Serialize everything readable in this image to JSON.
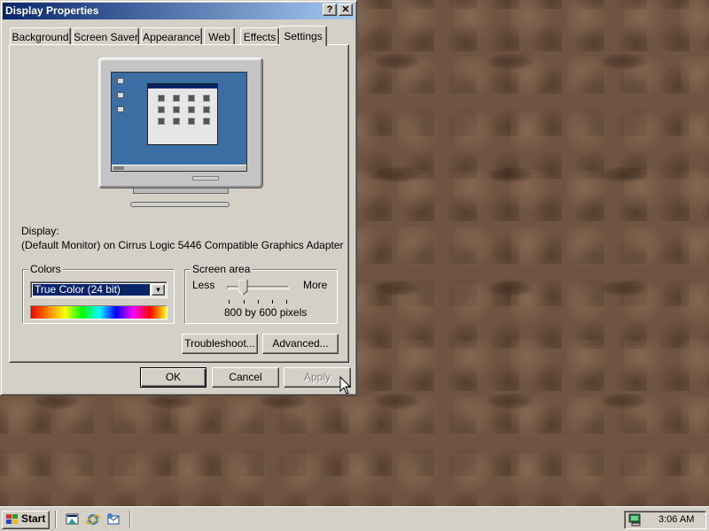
{
  "window": {
    "title": "Display Properties",
    "help_glyph": "?",
    "close_glyph": "✕"
  },
  "tabs": [
    {
      "label": "Background",
      "active": false
    },
    {
      "label": "Screen Saver",
      "active": false
    },
    {
      "label": "Appearance",
      "active": false
    },
    {
      "label": "Web",
      "active": false
    },
    {
      "label": "Effects",
      "active": false
    },
    {
      "label": "Settings",
      "active": true
    }
  ],
  "settings": {
    "display_label": "Display:",
    "display_value": "(Default Monitor) on Cirrus Logic 5446 Compatible Graphics Adapter",
    "colors": {
      "legend": "Colors",
      "selected": "True Color (24 bit)",
      "arrow_glyph": "▼"
    },
    "screen_area": {
      "legend": "Screen area",
      "less_label": "Less",
      "more_label": "More",
      "resolution": "800 by 600 pixels",
      "slider_step": 1,
      "slider_steps_total": 5
    },
    "troubleshoot_label": "Troubleshoot...",
    "advanced_label": "Advanced..."
  },
  "dialog_buttons": {
    "ok_label": "OK",
    "cancel_label": "Cancel",
    "apply_label": "Apply",
    "apply_disabled": true
  },
  "taskbar": {
    "start_label": "Start",
    "quick_launch": [
      "show-desktop-icon",
      "internet-explorer-icon",
      "outlook-express-icon"
    ],
    "tray_icon": "display-settings-icon",
    "clock": "3:06 AM"
  },
  "colors": {
    "titlebar_start": "#0a246a",
    "titlebar_end": "#a6caf0",
    "dialog_face": "#d4d0c8",
    "selection": "#0a246a",
    "desktop": "#6e5442"
  }
}
